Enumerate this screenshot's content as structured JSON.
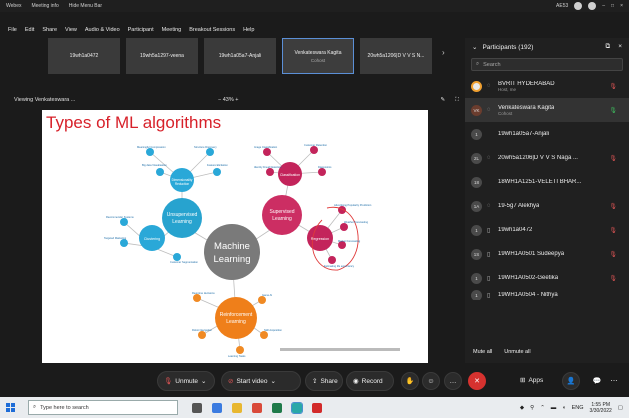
{
  "titlebar": {
    "app_name": "Webex",
    "meeting_info": "Meeting info",
    "hide_menu_bar": "Hide Menu Bar",
    "time_right": "AE53"
  },
  "menu": [
    "File",
    "Edit",
    "Share",
    "View",
    "Audio & Video",
    "Participant",
    "Meeting",
    "Breakout Sessions",
    "Help"
  ],
  "thumbnails": [
    {
      "name": "19wh1a0472",
      "sub": ""
    },
    {
      "name": "19wh5a1297-veena",
      "sub": ""
    },
    {
      "name": "19wh1a05a7-Anjali",
      "sub": ""
    },
    {
      "name": "Venkateswara Kagita",
      "sub": "Cohost"
    },
    {
      "name": "20wh5a1206|D V V S N...",
      "sub": ""
    }
  ],
  "viewbar": {
    "viewing": "Viewing Venkateswara ...",
    "zoom": "−  43%  +"
  },
  "slide": {
    "title": "Types of ML algorithms",
    "center": [
      "Machine",
      "Learning"
    ],
    "unsupervised": [
      "Unsupervised",
      "Learning"
    ],
    "supervised": [
      "Supervised",
      "Learning"
    ],
    "reinforcement": [
      "Reinforcement",
      "Learning"
    ],
    "dimensionality": [
      "Dimensionality",
      "Reduction"
    ],
    "clustering": "Clustering",
    "classification": "Classification",
    "regression": "Regression"
  },
  "participants": {
    "header": "Participants (192)",
    "search_placeholder": "Search",
    "list": [
      {
        "initials": "",
        "name": "BVRIT HYDERABAD",
        "role": "Host, me",
        "muted": true,
        "type": "host"
      },
      {
        "initials": "VK",
        "name": "Venkateswara Kagita",
        "role": "Cohost",
        "muted": false,
        "type": "cohost"
      },
      {
        "initials": "1",
        "name": "19wh1a05a7-Anjali",
        "role": "",
        "muted": false,
        "type": "normal"
      },
      {
        "initials": "2L",
        "name": "20wh5a1206|D V V S Naga ...",
        "role": "",
        "muted": true,
        "type": "normal"
      },
      {
        "initials": "18",
        "name": "18WH1A1251-VELETI BHAR...",
        "role": "",
        "muted": false,
        "type": "normal"
      },
      {
        "initials": "1A",
        "name": "19-5g7 Alekhya",
        "role": "",
        "muted": true,
        "type": "normal"
      },
      {
        "initials": "1",
        "name": "19wh1a0472",
        "role": "",
        "muted": true,
        "type": "normal"
      },
      {
        "initials": "1S",
        "name": "19WH1A0501 Sudeepya",
        "role": "",
        "muted": true,
        "type": "normal"
      },
      {
        "initials": "1",
        "name": "19WH1A0502-Geetika",
        "role": "",
        "muted": true,
        "type": "normal"
      },
      {
        "initials": "1",
        "name": "19WH1A0504 - Nithya",
        "role": "",
        "muted": true,
        "type": "normal"
      }
    ],
    "mute_all": "Mute all",
    "unmute_all": "Unmute all"
  },
  "controls": {
    "unmute": "Unmute",
    "start_video": "Start video",
    "share": "Share",
    "record": "Record",
    "apps": "Apps"
  },
  "taskbar": {
    "search_placeholder": "Type here to search",
    "time": "1:55 PM",
    "date": "3/30/2022",
    "lang": "ENG"
  }
}
